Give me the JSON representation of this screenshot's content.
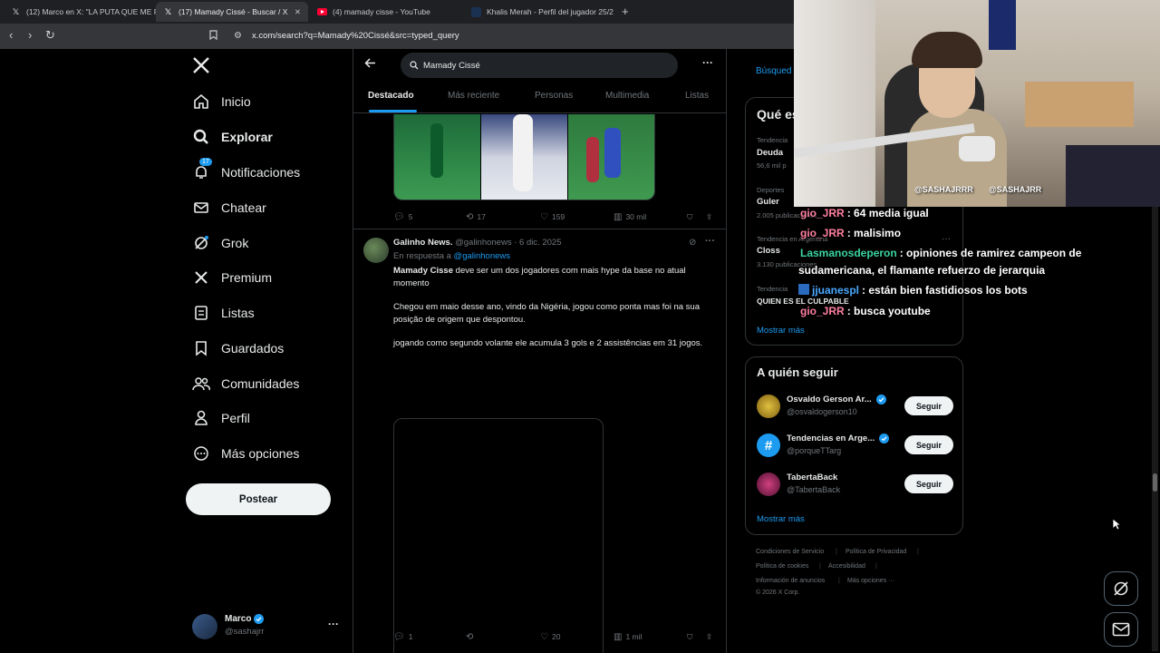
{
  "browser": {
    "tabs": [
      {
        "title": "(12) Marco en X: \"LA PUTA QUE ME F",
        "active": false,
        "favicon": "x-logo-icon"
      },
      {
        "title": "(17) Mamady Cissé - Buscar / X",
        "active": true,
        "favicon": "x-logo-icon"
      },
      {
        "title": "(4) mamady cisse - YouTube",
        "active": false,
        "favicon": "youtube-icon"
      },
      {
        "title": "Khalis Merah - Perfil del jugador 25/2",
        "active": false,
        "favicon": "transfermarkt-icon"
      }
    ],
    "url": "x.com/search?q=Mamady%20Cissé&src=typed_query"
  },
  "sidebar": {
    "items": [
      {
        "label": "Inicio",
        "icon": "home-icon"
      },
      {
        "label": "Explorar",
        "icon": "search-icon",
        "bold": true
      },
      {
        "label": "Notificaciones",
        "icon": "bell-icon",
        "badge": "17"
      },
      {
        "label": "Chatear",
        "icon": "mail-icon"
      },
      {
        "label": "Grok",
        "icon": "grok-icon"
      },
      {
        "label": "Premium",
        "icon": "x-logo-icon"
      },
      {
        "label": "Listas",
        "icon": "list-icon"
      },
      {
        "label": "Guardados",
        "icon": "bookmark-icon"
      },
      {
        "label": "Comunidades",
        "icon": "communities-icon"
      },
      {
        "label": "Perfil",
        "icon": "person-icon"
      },
      {
        "label": "Más opciones",
        "icon": "more-circle-icon"
      }
    ],
    "post_button": "Postear",
    "account": {
      "name": "Marco",
      "handle": "@sashajrr"
    }
  },
  "search": {
    "query": "Mamady Cissé",
    "tabs": [
      "Destacado",
      "Más reciente",
      "Personas",
      "Multimedia",
      "Listas"
    ]
  },
  "posts": [
    {
      "replies": "5",
      "reposts": "17",
      "likes": "159",
      "views": "30 mil"
    },
    {
      "author": "Galinho News.",
      "handle": "@galinhonews",
      "date": "· 6 dic. 2025",
      "reply_prefix": "En respuesta a",
      "reply_to": "@galinhonews",
      "text_bold": "Mamady Cisse",
      "text_line1_rest": " deve ser um dos jogadores com mais hype da base no atual momento",
      "text_para2": "Chegou em maio desse ano, vindo da Nigéria, jogou como ponta mas foi na sua posição de origem que despontou.",
      "text_para3": "jogando como segundo volante ele acumula 3 gols e 2 assistências em 31 jogos.",
      "replies": "1",
      "reposts": "",
      "likes": "20",
      "views": "1 mil"
    }
  ],
  "right": {
    "search_label": "Búsqued",
    "trends_title": "Qué es",
    "trends": [
      {
        "context": "Tendencia",
        "name": "Deuda",
        "count": "56,6 mil p"
      },
      {
        "context": "Deportes",
        "name": "Guler",
        "count": "2.005 publicaciones"
      },
      {
        "context": "Tendencia en Argentina",
        "name": "Closs",
        "count": "3.130 publicaciones"
      },
      {
        "context": "Tendencia",
        "name": "QUIEN ES EL CULPABLE",
        "count": ""
      }
    ],
    "show_more": "Mostrar más",
    "follow_title": "A quién seguir",
    "follow": [
      {
        "name": "Osvaldo Gerson Ar...",
        "handle": "@osvaldogerson10",
        "button": "Seguir"
      },
      {
        "name": "Tendencias en Arge...",
        "handle": "@porqueTTarg",
        "button": "Seguir"
      },
      {
        "name": "TabertaBack",
        "handle": "@TabertaBack",
        "button": "Seguir"
      }
    ],
    "show_more_2": "Mostrar más",
    "footer": [
      "Condiciones de Servicio",
      "Política de Privacidad",
      "Política de cookies",
      "Accesibilidad",
      "Información de anuncios",
      "Más opciones ···",
      "© 2026 X Corp."
    ]
  },
  "webcam": {
    "tag1": "@SASHAJRRR",
    "tag2": "@SASHAJRR"
  },
  "chat": [
    {
      "user": "gio_JRR",
      "message": ": 64 media igual",
      "color": "#ff7f9f"
    },
    {
      "user": "gio_JRR",
      "message": ": malisimo",
      "color": "#ff7f9f"
    },
    {
      "user": "Lasmanosdeperon",
      "message": ": opiniones de ramirez campeon de",
      "color": "#3ad3a0"
    },
    {
      "user": "",
      "message": "sudamericana, el flamante refuerzo de jerarquia",
      "color": "#ffffff"
    },
    {
      "user": "jjuanespl",
      "message": ": están bien fastidiosos los bots",
      "color": "#4aa8ff"
    },
    {
      "user": "gio_JRR",
      "message": ": busca youtube",
      "color": "#ff7f9f"
    }
  ]
}
